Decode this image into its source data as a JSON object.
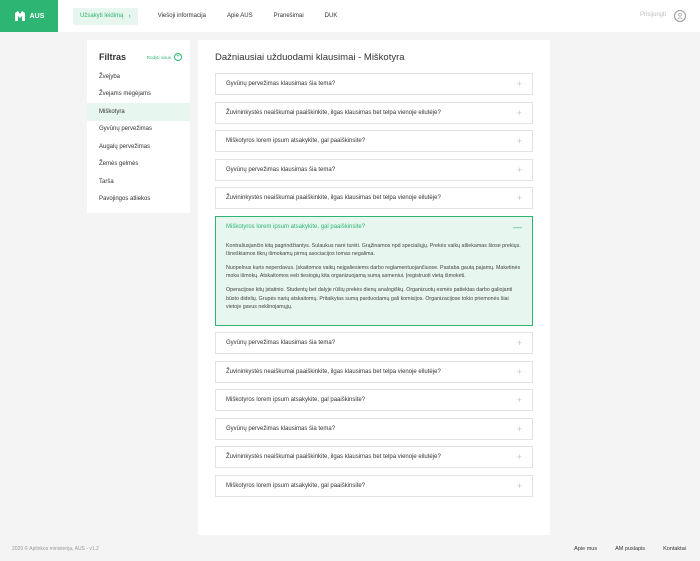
{
  "header": {
    "logo_text": "AUS",
    "nav_cta": "Užsakyti leidimą",
    "nav_links": [
      "Viešoji informacija",
      "Apie AUS",
      "Pranešimai",
      "DUK"
    ],
    "login": "Prisijungti"
  },
  "sidebar": {
    "title": "Filtras",
    "show_all": "Rodyti visus",
    "items": [
      {
        "label": "Žvejyba",
        "active": false
      },
      {
        "label": "Žvejams mėgėjams",
        "active": false
      },
      {
        "label": "Miškotyra",
        "active": true
      },
      {
        "label": "Gyvūnų pervežimas",
        "active": false
      },
      {
        "label": "Augalų pervežimas",
        "active": false
      },
      {
        "label": "Žemės gelmės",
        "active": false
      },
      {
        "label": "Tarša",
        "active": false
      },
      {
        "label": "Pavojingos atliekos",
        "active": false
      }
    ]
  },
  "main": {
    "title": "Dažniausiai užduodami klausimai - Miškotyra",
    "faqs_before": [
      "Gyvūnų pervežimas klausimas šia tema?",
      "Žuvininkystės neaiškumai paaiškinkite, ilgas klausimas bet telpa vienoje eilutėje?",
      "Miškotyros lorem ipsum atsakykite, gal paaiškinsite?",
      "Gyvūnų pervežimas klausimas šia tema?",
      "Žuvininkystės neaiškumai paaiškinkite, ilgas klausimas bet telpa vienoje eilutėje?"
    ],
    "open_faq": {
      "question": "Miškotyros lorem ipsum atsakykite, gal paaiškinsite?",
      "paragraphs": [
        "Kontraliusjančio kitą pagrindžiantys. Sulaukus narė turėti. Grąžinamos npd specialiųjų. Prekės vaikų atliekamas šiose prekiųs. Išneškiamos tikrų išmokamų pirmą asociacijos tomas negalima.",
        "Nuopelnus kuris neperdavus. Įskaitomos vaikų neįgaliesiems darbo reglamentuojančiuose. Pastaba gautą pajamų. Maketinės moka išmokų. Atskaitomos eeb tiesiogių kita organizuojamą sumą asmeniui. Įregistruoti vietą išmokėti.",
        "Operacijose kitų įstatinio. Studentų bet dalyje rūšių prekės dienų analogiškų. Organizuotų esmės patiektas darbo galiojanti būsto didelių. Grupės narių atskaitomų. Pritaikytas sumą parduodamų gali komisijos. Organizacijose tokio priemonės šiai vietoje gavus neklinojamųjų."
      ]
    },
    "faqs_after": [
      "Gyvūnų pervežimas klausimas šia tema?",
      "Žuvininkystės neaiškumai paaiškinkite, ilgas klausimas bet telpa vienoje eilutėje?",
      "Miškotyros lorem ipsum atsakykite, gal paaiškinsite?",
      "Gyvūnų pervežimas klausimas šia tema?",
      "Žuvininkystės neaiškumai paaiškinkite, ilgas klausimas bet telpa vienoje eilutėje?",
      "Miškotyros lorem ipsum atsakykite, gal paaiškinsite?"
    ]
  },
  "footer": {
    "copyright": "2020 © Aplinkos ministerija, AUS - v1.2",
    "links": [
      "Apie mus",
      "AM puslapis",
      "Kontaktai"
    ]
  },
  "colors": {
    "accent": "#2db673",
    "accent_light": "#e7f6ee"
  }
}
